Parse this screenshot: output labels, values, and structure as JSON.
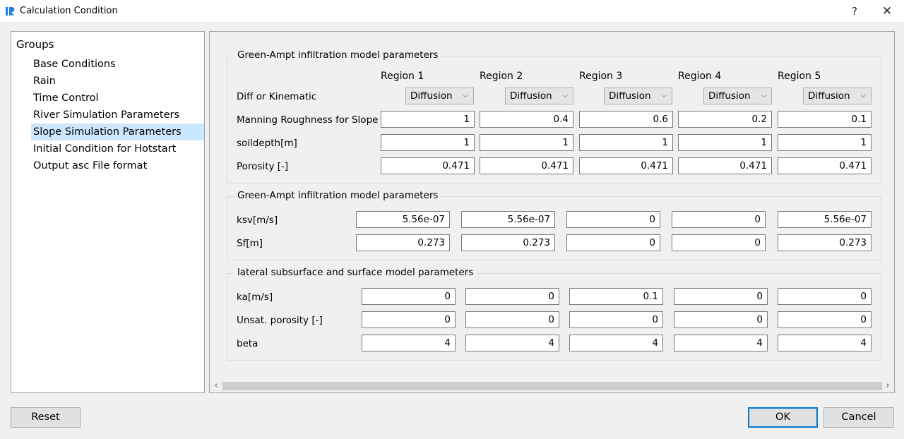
{
  "window": {
    "title": "Calculation Condition",
    "help_label": "?",
    "close_label": "✕"
  },
  "groups": {
    "title": "Groups",
    "items": [
      {
        "label": "Base Conditions",
        "selected": false
      },
      {
        "label": "Rain",
        "selected": false
      },
      {
        "label": "Time Control",
        "selected": false
      },
      {
        "label": "River Simulation Parameters",
        "selected": false
      },
      {
        "label": "Slope Simulation Parameters",
        "selected": true
      },
      {
        "label": "Initial Condition for Hotstart",
        "selected": false
      },
      {
        "label": "Output asc File format",
        "selected": false
      }
    ]
  },
  "section1": {
    "title": "Green-Ampt infiltration model parameters",
    "regions": [
      "Region 1",
      "Region 2",
      "Region 3",
      "Region 4",
      "Region 5"
    ],
    "diff_label": "Diff or Kinematic",
    "diff_values": [
      "Diffusion",
      "Diffusion",
      "Diffusion",
      "Diffusion",
      "Diffusion"
    ],
    "rows": [
      {
        "label": "Manning Roughness for Slope",
        "values": [
          "1",
          "0.4",
          "0.6",
          "0.2",
          "0.1"
        ]
      },
      {
        "label": "soildepth[m]",
        "values": [
          "1",
          "1",
          "1",
          "1",
          "1"
        ]
      },
      {
        "label": "Porosity [-]",
        "values": [
          "0.471",
          "0.471",
          "0.471",
          "0.471",
          "0.471"
        ]
      }
    ]
  },
  "section2": {
    "title": "Green-Ampt infiltration model parameters",
    "rows": [
      {
        "label": "ksv[m/s]",
        "values": [
          "5.56e-07",
          "5.56e-07",
          "0",
          "0",
          "5.56e-07"
        ]
      },
      {
        "label": "Sf[m]",
        "values": [
          "0.273",
          "0.273",
          "0",
          "0",
          "0.273"
        ]
      }
    ]
  },
  "section3": {
    "title": "lateral subsurface and surface model parameters",
    "rows": [
      {
        "label": "ka[m/s]",
        "values": [
          "0",
          "0",
          "0.1",
          "0",
          "0"
        ]
      },
      {
        "label": "Unsat. porosity [-]",
        "values": [
          "0",
          "0",
          "0",
          "0",
          "0"
        ]
      },
      {
        "label": "beta",
        "values": [
          "4",
          "4",
          "4",
          "4",
          "4"
        ]
      }
    ]
  },
  "scrollbar": {
    "left_arrow": "‹",
    "right_arrow": "›"
  },
  "buttons": {
    "reset": "Reset",
    "ok": "OK",
    "cancel": "Cancel"
  }
}
